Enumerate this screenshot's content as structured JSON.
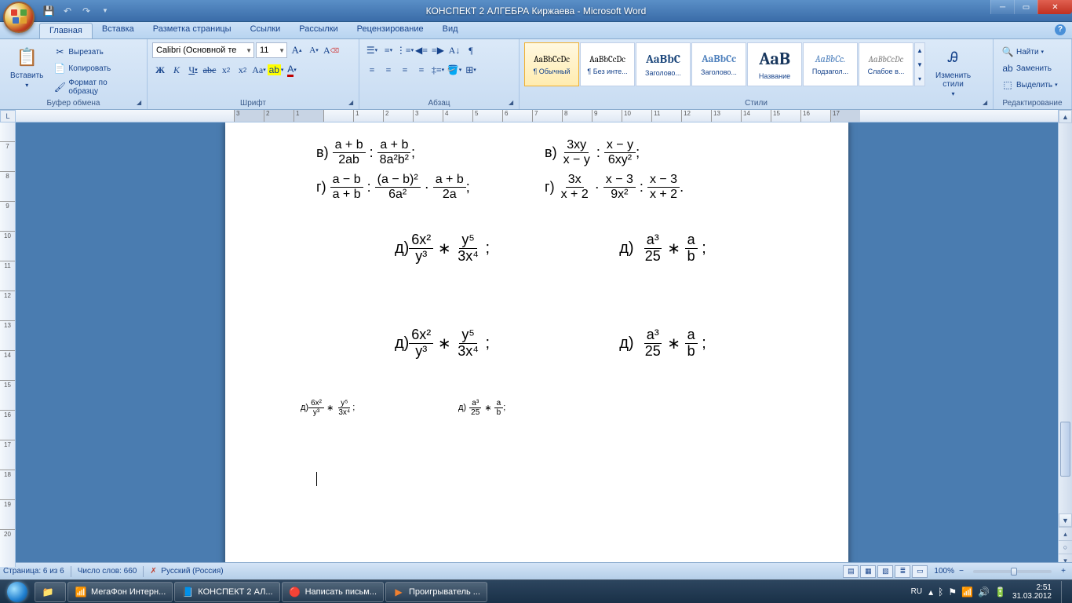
{
  "title": "КОНСПЕКТ 2 АЛГЕБРА Киржаева - Microsoft Word",
  "tabs": [
    "Главная",
    "Вставка",
    "Разметка страницы",
    "Ссылки",
    "Рассылки",
    "Рецензирование",
    "Вид"
  ],
  "active_tab": 0,
  "clipboard": {
    "paste": "Вставить",
    "cut": "Вырезать",
    "copy": "Копировать",
    "format_painter": "Формат по образцу",
    "label": "Буфер обмена"
  },
  "font": {
    "name": "Calibri (Основной те",
    "size": "11",
    "label": "Шрифт"
  },
  "para": {
    "label": "Абзац"
  },
  "styles": {
    "label": "Стили",
    "items": [
      {
        "preview": "AaBbCcDc",
        "name": "¶ Обычный",
        "selected": true,
        "color": "#000",
        "fs": 11
      },
      {
        "preview": "AaBbCcDc",
        "name": "¶ Без инте...",
        "color": "#000",
        "fs": 11
      },
      {
        "preview": "AaBbC",
        "name": "Заголово...",
        "color": "#1f497d",
        "fs": 15,
        "bold": true
      },
      {
        "preview": "AaBbCc",
        "name": "Заголово...",
        "color": "#4f81bd",
        "fs": 13,
        "bold": true
      },
      {
        "preview": "AaB",
        "name": "Название",
        "color": "#17365d",
        "fs": 22,
        "bold": true
      },
      {
        "preview": "AaBbCc.",
        "name": "Подзагол...",
        "color": "#4f81bd",
        "fs": 12,
        "italic": true
      },
      {
        "preview": "AaBbCcDc",
        "name": "Слабое в...",
        "color": "#808080",
        "fs": 11,
        "italic": true
      }
    ],
    "change": "Изменить\nстили"
  },
  "editing": {
    "find": "Найти",
    "replace": "Заменить",
    "select": "Выделить",
    "label": "Редактирование"
  },
  "status": {
    "page": "Страница: 6 из 6",
    "words": "Число слов: 660",
    "lang": "Русский (Россия)",
    "zoom": "100%"
  },
  "taskbar": {
    "items": [
      {
        "icon": "📁",
        "label": ""
      },
      {
        "icon": "📶",
        "label": "МегаФон Интерн...",
        "color": "#40c060"
      },
      {
        "icon": "📘",
        "label": "КОНСПЕКТ 2 АЛ...",
        "color": "#2b579a"
      },
      {
        "icon": "🔴",
        "label": "Написать письм...",
        "color": "#e03020"
      },
      {
        "icon": "▶",
        "label": "Проигрыватель ...",
        "color": "#f08030"
      }
    ],
    "lang": "RU",
    "time": "2:51",
    "date": "31.03.2012"
  },
  "hruler_ticks": [
    "3",
    "2",
    "1",
    "",
    "1",
    "2",
    "3",
    "4",
    "5",
    "6",
    "7",
    "8",
    "9",
    "10",
    "11",
    "12",
    "13",
    "14",
    "15",
    "16",
    "17"
  ],
  "vruler_ticks": [
    "",
    "7",
    "8",
    "9",
    "10",
    "11",
    "12",
    "13",
    "14",
    "15",
    "16",
    "17",
    "18",
    "19",
    "20"
  ],
  "math": {
    "line1_left_label": "в)",
    "line1_left": {
      "f1n": "a + b",
      "f1d": "2ab",
      "op": ":",
      "f2n": "a + b",
      "f2d": "8a²b²",
      "end": ";"
    },
    "line1_right_label": "в)",
    "line1_right": {
      "f1n": "3xy",
      "f1d": "x − y",
      "op": ":",
      "f2n": "x − y",
      "f2d": "6xy²",
      "end": ";"
    },
    "line2_left_label": "г)",
    "line2_left": {
      "f1n": "a − b",
      "f1d": "a + b",
      "op1": ":",
      "f2n": "(a − b)²",
      "f2d": "6a²",
      "op2": "·",
      "f3n": "a + b",
      "f3d": "2a",
      "end": ";"
    },
    "line2_right_label": "г)",
    "line2_right": {
      "f1n": "3x",
      "f1d": "x + 2",
      "op1": "·",
      "f2n": "x − 3",
      "f2d": "9x²",
      "op2": ":",
      "f3n": "x − 3",
      "f3d": "x + 2",
      "end": "."
    },
    "block_d_left_label": "д)",
    "block_d_left": {
      "f1n": "6x²",
      "f1d": "y³",
      "op": "∗",
      "f2n": "y⁵",
      "f2d": "3x⁴",
      "end": ";"
    },
    "block_d_right_label": "д)",
    "block_d_right": {
      "f1n": "a³",
      "f1d": "25",
      "op": "∗",
      "f2n": "a",
      "f2d": "b",
      "end": ";"
    }
  }
}
